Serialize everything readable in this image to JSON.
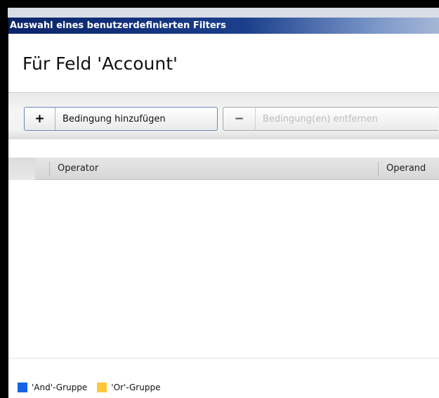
{
  "window": {
    "title": "Auswahl eines benutzerdefinierten Filters"
  },
  "main": {
    "heading": "Für Feld 'Account'"
  },
  "toolbar": {
    "add": {
      "symbol": "+",
      "label": "Bedingung hinzufügen",
      "enabled": true
    },
    "remove": {
      "symbol": "−",
      "label": "Bedingung(en) entfernen",
      "enabled": false
    }
  },
  "grid": {
    "columns": [
      "Operator",
      "Operand"
    ],
    "rows": []
  },
  "legend": {
    "items": [
      {
        "label": "'And'-Gruppe",
        "color": "#1663e6"
      },
      {
        "label": "'Or'-Gruppe",
        "color": "#ffc83a"
      }
    ]
  }
}
